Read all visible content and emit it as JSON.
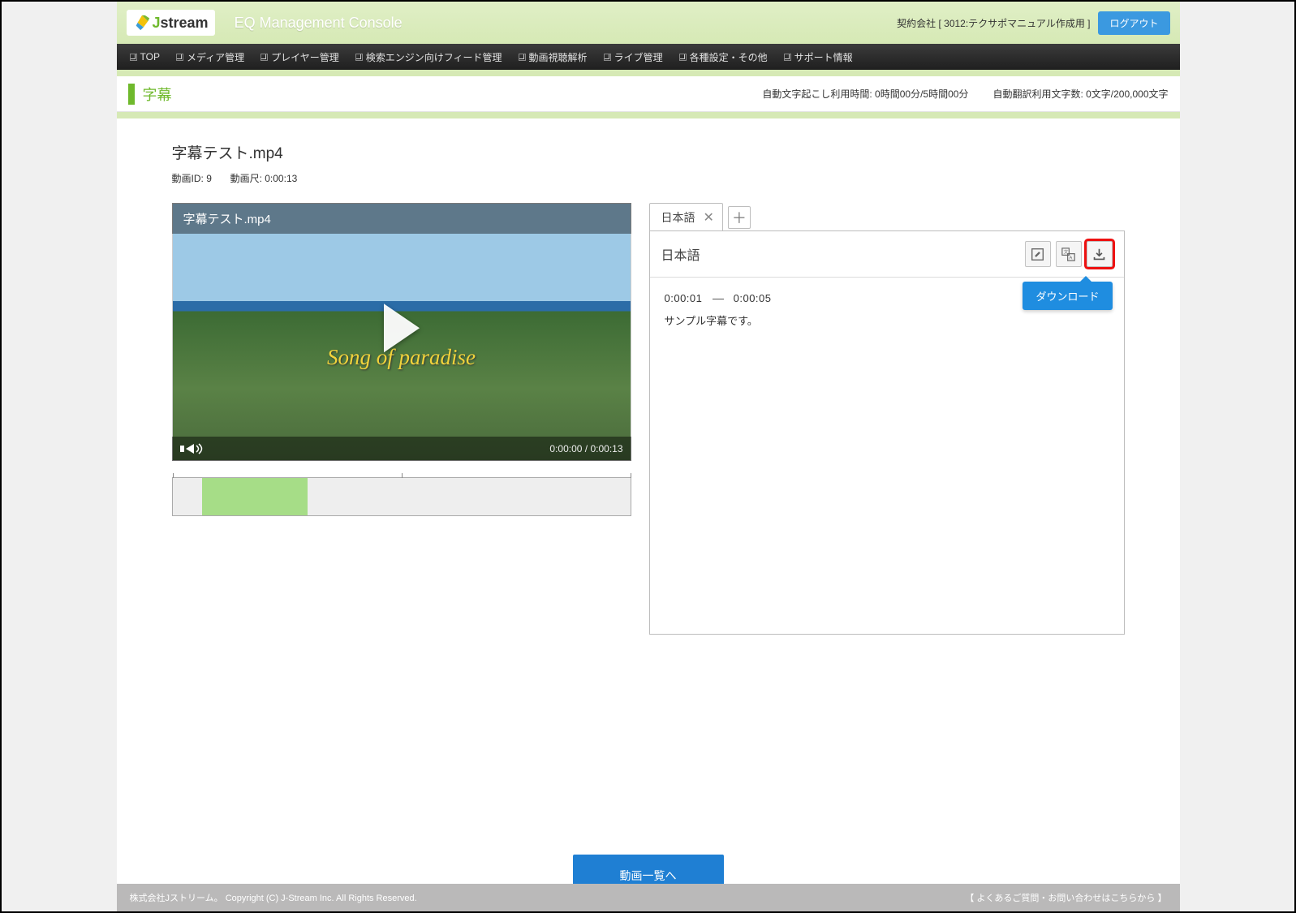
{
  "header": {
    "brand_name": "stream",
    "console_title": "EQ Management Console",
    "contract_label": "契約会社 [ 3012:テクサポマニュアル作成用 ]",
    "logout_label": "ログアウト"
  },
  "nav": {
    "items": [
      "TOP",
      "メディア管理",
      "プレイヤー管理",
      "検索エンジン向けフィード管理",
      "動画視聴解析",
      "ライブ管理",
      "各種設定・その他",
      "サポート情報"
    ]
  },
  "title_bar": {
    "title": "字幕",
    "usage_transcribe": "自動文字起こし利用時間: 0時間00分/5時間00分",
    "usage_translate": "自動翻訳利用文字数: 0文字/200,000文字"
  },
  "file": {
    "name": "字幕テスト.mp4",
    "meta_id_label": "動画ID:",
    "meta_id_value": "9",
    "meta_duration_label": "動画尺:",
    "meta_duration_value": "0:00:13"
  },
  "video": {
    "overlay_title": "字幕テスト.mp4",
    "caption": "Song of paradise",
    "time_display": "0:00:00 / 0:00:13"
  },
  "tabs": {
    "items": [
      {
        "label": "日本語"
      }
    ]
  },
  "panel": {
    "title": "日本語",
    "tooltip": "ダウンロード",
    "entry": {
      "start": "0:00:01",
      "end": "0:00:05",
      "text": "サンプル字幕です。"
    }
  },
  "buttons": {
    "back_to_list": "動画一覧へ"
  },
  "footer": {
    "copyright": "株式会社Jストリーム。 Copyright (C) J-Stream Inc. All Rights Reserved.",
    "faq_link": "【 よくあるご質問・お問い合わせはこちらから 】"
  }
}
